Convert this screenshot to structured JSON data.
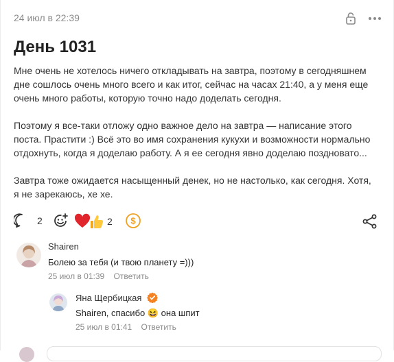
{
  "post": {
    "date": "24 июл в 22:39",
    "title": "День 1031",
    "paragraphs": [
      "Мне очень не хотелось ничего откладывать на завтра, поэтому в сегодняшнем дне сошлось очень много всего и как итог, сейчас на часах 21:40, а у меня еще очень много работы, которую точно надо доделать сегодня.",
      "Поэтому я все-таки отложу одно важное дело на завтра — написание этого поста. Прастити :) Всё это во имя сохранения кукухи и возможности нормально отдохнуть, когда я доделаю работу. А я ее сегодня явно доделаю поздновато...",
      "Завтра тоже ожидается насыщенный денек, но не настолько, как сегодня. Хотя, я не зарекаюсь, хе хе."
    ],
    "comments_count": "2",
    "reactions_count": "2"
  },
  "icons": {
    "lock": "lock-icon",
    "more": "more-dots-icon",
    "comment": "comment-bubble-icon",
    "add_reaction": "add-reaction-icon",
    "heart": "heart-emoji",
    "thumbs": "thumbs-up-emoji",
    "donate": "coin-icon",
    "share": "share-icon",
    "verified": "verified-badge-icon"
  },
  "colors": {
    "accent_orange": "#f0a020",
    "heart": "#e0262c",
    "muted": "#8a8a8a"
  },
  "comments": [
    {
      "author": "Shairen",
      "text": "Болею за тебя (и твою планету =)))",
      "time": "25 июл в 01:39",
      "reply": "Ответить"
    },
    {
      "author": "Яна Щербицкая",
      "text_prefix": "Shairen, спасибо ",
      "emoji": "😆",
      "text_suffix": " она шпит",
      "time": "25 июл в 01:41",
      "reply": "Ответить"
    }
  ]
}
